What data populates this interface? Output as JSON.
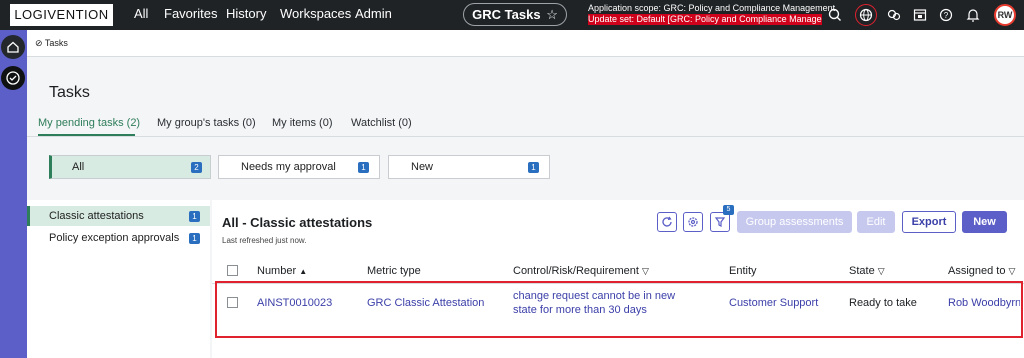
{
  "topbar": {
    "logo": "LOGIVENTION",
    "nav": [
      "All",
      "Favorites",
      "History",
      "Workspaces",
      "Admin"
    ],
    "app_title": "GRC Tasks",
    "app_scope": "Application scope: GRC: Policy and Compliance Management",
    "update_set": "Update set: Default [GRC: Policy and Compliance Managem...",
    "avatar_initials": "RW",
    "icons": [
      "search-icon",
      "globe-icon",
      "chat-icon",
      "inbox-icon",
      "help-icon",
      "bell-icon"
    ]
  },
  "breadcrumb": "Tasks",
  "page": {
    "title": "Tasks",
    "tabs": [
      "My pending tasks (2)",
      "My group's tasks (0)",
      "My items (0)",
      "Watchlist (0)"
    ]
  },
  "filters": [
    {
      "label": "All",
      "count": "2"
    },
    {
      "label": "Needs my approval",
      "count": "1"
    },
    {
      "label": "New",
      "count": "1"
    }
  ],
  "sidebar": {
    "items": [
      {
        "label": "Classic attestations",
        "count": "1"
      },
      {
        "label": "Policy exception approvals",
        "count": "1"
      }
    ]
  },
  "list": {
    "title": "All - Classic attestations",
    "refreshed": "Last refreshed just now.",
    "filter_badge": "5",
    "buttons": {
      "group": "Group assessments",
      "edit": "Edit",
      "export": "Export",
      "new": "New"
    },
    "columns": [
      "Number",
      "Metric type",
      "Control/Risk/Requirement",
      "Entity",
      "State",
      "Assigned to"
    ],
    "rows": [
      {
        "number": "AINST0010023",
        "metric_type": "GRC Classic Attestation",
        "control_line1": "change request cannot be in new",
        "control_line2": "state for more than 30 days",
        "entity": "Customer Support",
        "state": "Ready to take",
        "assigned_to": "Rob Woodbyrn"
      }
    ]
  },
  "colors": {
    "accent": "#5b5fc7",
    "selected_green": "#2e7d5b",
    "highlight": "#e0212e"
  }
}
